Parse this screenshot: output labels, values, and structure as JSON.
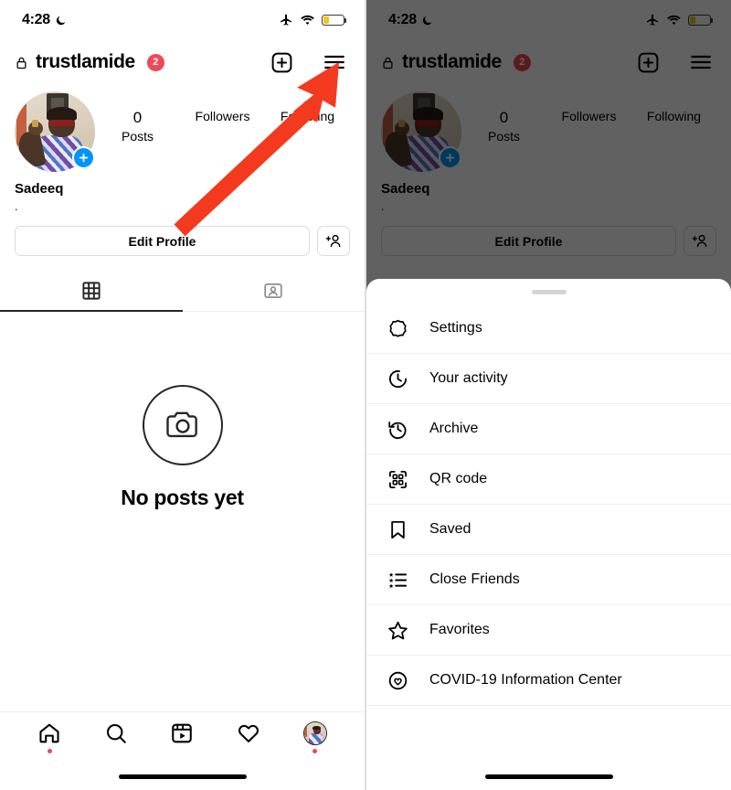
{
  "status_bar": {
    "time": "4:28",
    "moon_icon": "crescent-moon-icon",
    "airplane_icon": "airplane-mode-icon",
    "wifi_icon": "wifi-icon",
    "battery_icon": "battery-low-icon",
    "battery_percent": 25
  },
  "header": {
    "lock_icon": "private-lock-icon",
    "username": "trustlamide",
    "badge_count": "2",
    "badge_color": "#ED4956",
    "add_icon": "new-post-plus-icon",
    "menu_icon": "hamburger-menu-icon"
  },
  "profile": {
    "avatar_name": "profile-avatar",
    "add_story_icon": "add-story-plus-icon",
    "full_name": "Sadeeq",
    "bio": ".",
    "stats": [
      {
        "value": "0",
        "label": "Posts"
      },
      {
        "value": "",
        "label": "Followers"
      },
      {
        "value": "",
        "label": "Following"
      }
    ]
  },
  "actions": {
    "edit_profile_label": "Edit Profile",
    "add_person_icon": "add-person-icon"
  },
  "tabs": [
    {
      "icon": "grid-posts-icon",
      "active": true
    },
    {
      "icon": "tagged-person-icon",
      "active": false
    }
  ],
  "empty_state": {
    "icon": "camera-circle-icon",
    "title": "No posts yet"
  },
  "bottom_nav": [
    {
      "icon": "home-icon",
      "dot": true
    },
    {
      "icon": "search-icon",
      "dot": false
    },
    {
      "icon": "reels-icon",
      "dot": false
    },
    {
      "icon": "heart-activity-icon",
      "dot": false
    },
    {
      "icon": "profile-avatar-icon",
      "dot": true
    }
  ],
  "sheet": {
    "handle": "drag-handle",
    "items": [
      {
        "icon": "gear-settings-icon",
        "label": "Settings"
      },
      {
        "icon": "clock-activity-icon",
        "label": "Your activity"
      },
      {
        "icon": "archive-clock-icon",
        "label": "Archive"
      },
      {
        "icon": "qr-code-icon",
        "label": "QR code"
      },
      {
        "icon": "bookmark-saved-icon",
        "label": "Saved"
      },
      {
        "icon": "close-friends-list-icon",
        "label": "Close Friends"
      },
      {
        "icon": "star-favorites-icon",
        "label": "Favorites"
      },
      {
        "icon": "covid-info-icon",
        "label": "COVID-19 Information Center"
      }
    ]
  },
  "annotation": {
    "arrow_color": "#F33A1E",
    "points_to": "hamburger-menu-icon"
  }
}
